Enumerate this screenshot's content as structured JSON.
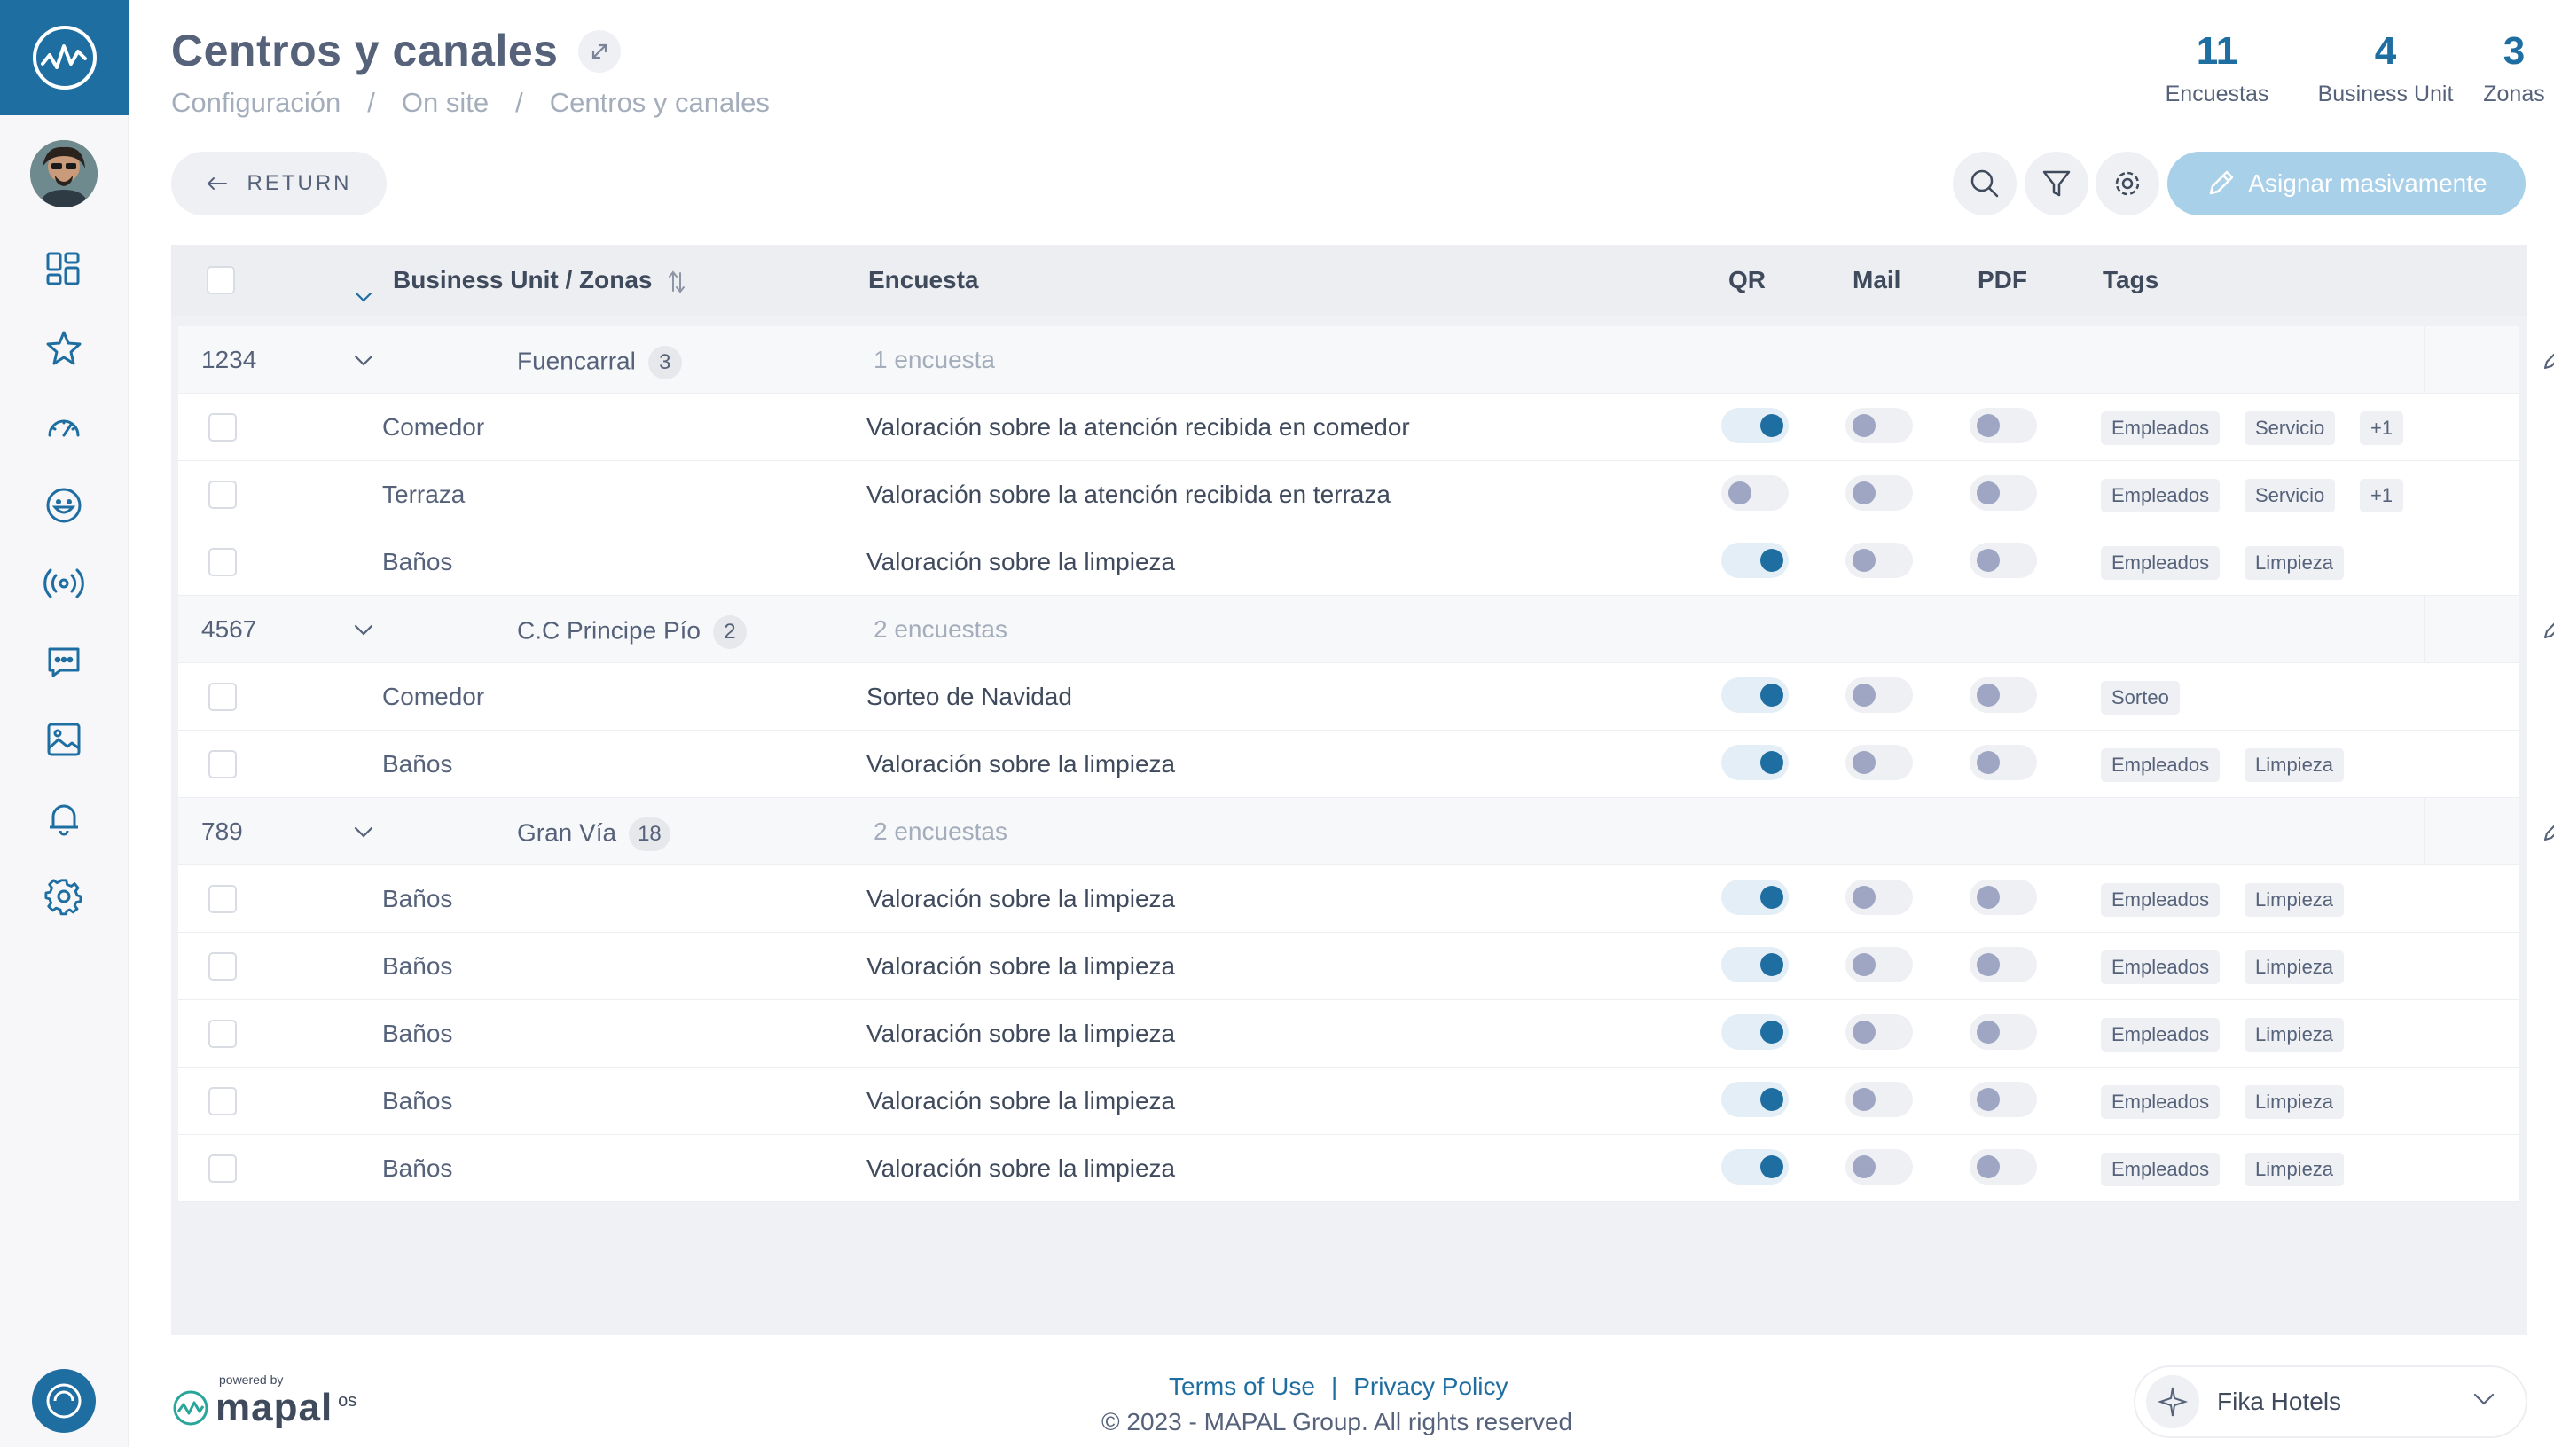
{
  "header": {
    "title": "Centros y canales",
    "breadcrumb": [
      "Configuración",
      "On site",
      "Centros y canales"
    ],
    "breadcrumb_sep": "/"
  },
  "stats": [
    {
      "value": "11",
      "label": "Encuestas"
    },
    {
      "value": "4",
      "label": "Business Unit"
    },
    {
      "value": "3",
      "label": "Zonas"
    }
  ],
  "toolbar": {
    "return_label": "RETURN",
    "assign_label": "Asignar masivamente"
  },
  "table": {
    "columns": {
      "bu": "Business Unit / Zonas",
      "survey": "Encuesta",
      "qr": "QR",
      "mail": "Mail",
      "pdf": "PDF",
      "tags": "Tags"
    },
    "groups": [
      {
        "code": "1234",
        "name": "Fuencarral",
        "count": "3",
        "surveys": "1 encuesta",
        "rows": [
          {
            "zone": "Comedor",
            "survey": "Valoración sobre la atención recibida en comedor",
            "qr": true,
            "mail": false,
            "pdf": false,
            "tags": [
              "Empleados",
              "Servicio",
              "+1"
            ]
          },
          {
            "zone": "Terraza",
            "survey": "Valoración sobre la atención recibida en terraza",
            "qr": false,
            "mail": false,
            "pdf": false,
            "tags": [
              "Empleados",
              "Servicio",
              "+1"
            ]
          },
          {
            "zone": "Baños",
            "survey": "Valoración sobre la limpieza",
            "qr": true,
            "mail": false,
            "pdf": false,
            "tags": [
              "Empleados",
              "Limpieza"
            ]
          }
        ]
      },
      {
        "code": "4567",
        "name": "C.C Principe Pío",
        "count": "2",
        "surveys": "2 encuestas",
        "rows": [
          {
            "zone": "Comedor",
            "survey": "Sorteo de Navidad",
            "qr": true,
            "mail": false,
            "pdf": false,
            "tags": [
              "Sorteo"
            ]
          },
          {
            "zone": "Baños",
            "survey": "Valoración sobre la limpieza",
            "qr": true,
            "mail": false,
            "pdf": false,
            "tags": [
              "Empleados",
              "Limpieza"
            ]
          }
        ]
      },
      {
        "code": "789",
        "name": "Gran Vía",
        "count": "18",
        "surveys": "2 encuestas",
        "rows": [
          {
            "zone": "Baños",
            "survey": "Valoración sobre la limpieza",
            "qr": true,
            "mail": false,
            "pdf": false,
            "tags": [
              "Empleados",
              "Limpieza"
            ]
          },
          {
            "zone": "Baños",
            "survey": "Valoración sobre la limpieza",
            "qr": true,
            "mail": false,
            "pdf": false,
            "tags": [
              "Empleados",
              "Limpieza"
            ]
          },
          {
            "zone": "Baños",
            "survey": "Valoración sobre la limpieza",
            "qr": true,
            "mail": false,
            "pdf": false,
            "tags": [
              "Empleados",
              "Limpieza"
            ]
          },
          {
            "zone": "Baños",
            "survey": "Valoración sobre la limpieza",
            "qr": true,
            "mail": false,
            "pdf": false,
            "tags": [
              "Empleados",
              "Limpieza"
            ]
          },
          {
            "zone": "Baños",
            "survey": "Valoración sobre la limpieza",
            "qr": true,
            "mail": false,
            "pdf": false,
            "tags": [
              "Empleados",
              "Limpieza"
            ]
          }
        ]
      }
    ]
  },
  "footer": {
    "powered_by": "powered by",
    "brand": "mapal",
    "brand_suffix": "os",
    "terms": "Terms of Use",
    "links_sep": "|",
    "privacy": "Privacy Policy",
    "copyright": "© 2023 - MAPAL Group. All rights reserved",
    "company": "Fika Hotels"
  },
  "colors": {
    "brand": "#1f6ea2",
    "assign_button": "#a9d0e9",
    "toggle_knob_off": "#9ea6c3"
  },
  "icons": {
    "sidebar": [
      "dashboard-icon",
      "star-icon",
      "gauge-icon",
      "smiley-icon",
      "broadcast-icon",
      "chat-icon",
      "image-icon",
      "bell-icon",
      "gear-icon"
    ],
    "toolbar": [
      "search-icon",
      "filter-icon",
      "gear-icon",
      "pencil-icon"
    ]
  }
}
